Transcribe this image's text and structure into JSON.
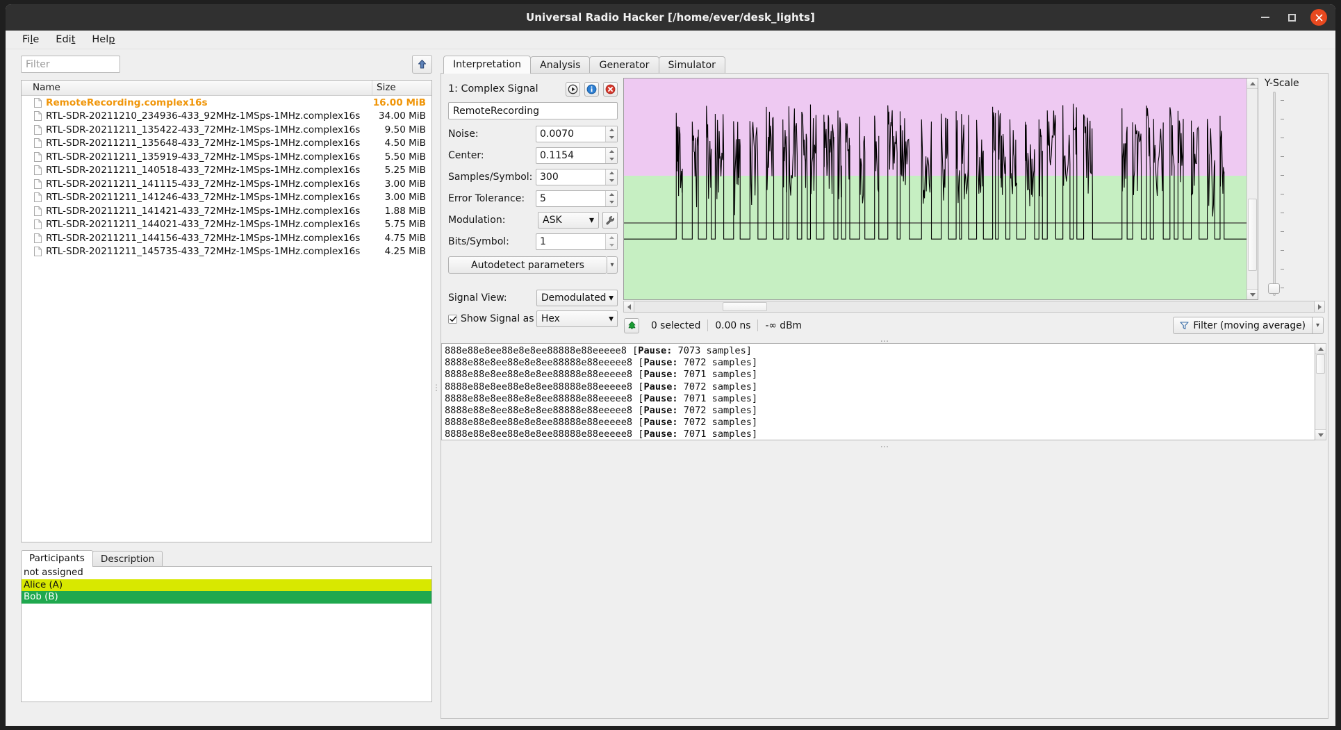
{
  "window": {
    "title": "Universal Radio Hacker [/home/ever/desk_lights]",
    "minimize_label": "Minimize",
    "maximize_label": "Maximize",
    "close_label": "Close"
  },
  "menubar": [
    {
      "label": "File",
      "mnemonic": "l"
    },
    {
      "label": "Edit",
      "mnemonic": "t"
    },
    {
      "label": "Help",
      "mnemonic": "p"
    }
  ],
  "left": {
    "filter_placeholder": "Filter",
    "filter_value": "",
    "open_button_icon": "up-arrow-icon",
    "table": {
      "columns": [
        "Name",
        "Size"
      ],
      "rows": [
        {
          "name": "RemoteRecording.complex16s",
          "size": "16.00 MiB",
          "highlight": true
        },
        {
          "name": "RTL-SDR-20211210_234936-433_92MHz-1MSps-1MHz.complex16s",
          "size": "34.00 MiB",
          "highlight": false
        },
        {
          "name": "RTL-SDR-20211211_135422-433_72MHz-1MSps-1MHz.complex16s",
          "size": "9.50 MiB",
          "highlight": false
        },
        {
          "name": "RTL-SDR-20211211_135648-433_72MHz-1MSps-1MHz.complex16s",
          "size": "4.50 MiB",
          "highlight": false
        },
        {
          "name": "RTL-SDR-20211211_135919-433_72MHz-1MSps-1MHz.complex16s",
          "size": "5.50 MiB",
          "highlight": false
        },
        {
          "name": "RTL-SDR-20211211_140518-433_72MHz-1MSps-1MHz.complex16s",
          "size": "5.25 MiB",
          "highlight": false
        },
        {
          "name": "RTL-SDR-20211211_141115-433_72MHz-1MSps-1MHz.complex16s",
          "size": "3.00 MiB",
          "highlight": false
        },
        {
          "name": "RTL-SDR-20211211_141246-433_72MHz-1MSps-1MHz.complex16s",
          "size": "3.00 MiB",
          "highlight": false
        },
        {
          "name": "RTL-SDR-20211211_141421-433_72MHz-1MSps-1MHz.complex16s",
          "size": "1.88 MiB",
          "highlight": false
        },
        {
          "name": "RTL-SDR-20211211_144021-433_72MHz-1MSps-1MHz.complex16s",
          "size": "5.75 MiB",
          "highlight": false
        },
        {
          "name": "RTL-SDR-20211211_144156-433_72MHz-1MSps-1MHz.complex16s",
          "size": "4.75 MiB",
          "highlight": false
        },
        {
          "name": "RTL-SDR-20211211_145735-433_72MHz-1MSps-1MHz.complex16s",
          "size": "4.25 MiB",
          "highlight": false
        }
      ]
    },
    "bottom_tabs": [
      {
        "label": "Participants",
        "active": true
      },
      {
        "label": "Description",
        "active": false
      }
    ],
    "participants": [
      {
        "label": "not assigned",
        "bg": "#ffffff",
        "fg": "#111111"
      },
      {
        "label": "Alice (A)",
        "bg": "#d8e800",
        "fg": "#111111"
      },
      {
        "label": "Bob (B)",
        "bg": "#1fa84e",
        "fg": "#ffffff"
      }
    ]
  },
  "main_tabs": [
    {
      "label": "Interpretation",
      "active": true
    },
    {
      "label": "Analysis",
      "active": false
    },
    {
      "label": "Generator",
      "active": false
    },
    {
      "label": "Simulator",
      "active": false
    }
  ],
  "signal": {
    "header": "1:  Complex Signal",
    "play_icon": "play-icon",
    "info_icon": "info-icon",
    "close_icon": "close-signal-icon",
    "name_value": "RemoteRecording",
    "params": [
      {
        "label": "Noise:",
        "value": "0.0070"
      },
      {
        "label": "Center:",
        "value": "0.1154"
      },
      {
        "label": "Samples/Symbol:",
        "value": "300"
      },
      {
        "label": "Error Tolerance:",
        "value": "5"
      }
    ],
    "modulation_label": "Modulation:",
    "modulation_value": "ASK",
    "modulation_tool_icon": "wrench-icon",
    "bits_label": "Bits/Symbol:",
    "bits_value": "1",
    "autodetect_label": "Autodetect parameters",
    "signal_view_label": "Signal View:",
    "signal_view_value": "Demodulated",
    "show_signal_label": "Show Signal as",
    "show_signal_value": "Hex",
    "show_signal_checked": true
  },
  "plot": {
    "yscale_label": "Y-Scale",
    "color_upper": "#eec9f2",
    "color_lower": "#c6efc2",
    "color_wave": "#000000",
    "zero_line_color": "#6f7a6a"
  },
  "statusbar": {
    "zoom_icon": "zoom-fit-icon",
    "selected": "0  selected",
    "duration": "0.00 ns",
    "power": "-∞ dBm",
    "filter_icon": "funnel-icon",
    "filter_label": "Filter (moving average)"
  },
  "hexview": {
    "lines": [
      {
        "data": "888e88e8ee88e8e8ee88888e88eeeee8",
        "pause_label": "Pause:",
        "pause_value": "7073 samples"
      },
      {
        "data": "8888e88e8ee88e8e8ee88888e88eeeee8",
        "pause_label": "Pause:",
        "pause_value": "7072 samples"
      },
      {
        "data": "8888e88e8ee88e8e8ee88888e88eeeee8",
        "pause_label": "Pause:",
        "pause_value": "7071 samples"
      },
      {
        "data": "8888e88e8ee88e8e8ee88888e88eeeee8",
        "pause_label": "Pause:",
        "pause_value": "7072 samples"
      },
      {
        "data": "8888e88e8ee88e8e8ee88888e88eeeee8",
        "pause_label": "Pause:",
        "pause_value": "7071 samples"
      },
      {
        "data": "8888e88e8ee88e8e8ee88888e88eeeee8",
        "pause_label": "Pause:",
        "pause_value": "7072 samples"
      },
      {
        "data": "8888e88e8ee88e8e8ee88888e88eeeee8",
        "pause_label": "Pause:",
        "pause_value": "7072 samples"
      },
      {
        "data": "8888e88e8ee88e8e8ee88888e88eeeee8",
        "pause_label": "Pause:",
        "pause_value": "7071 samples"
      }
    ]
  },
  "splitter_handle": "..."
}
